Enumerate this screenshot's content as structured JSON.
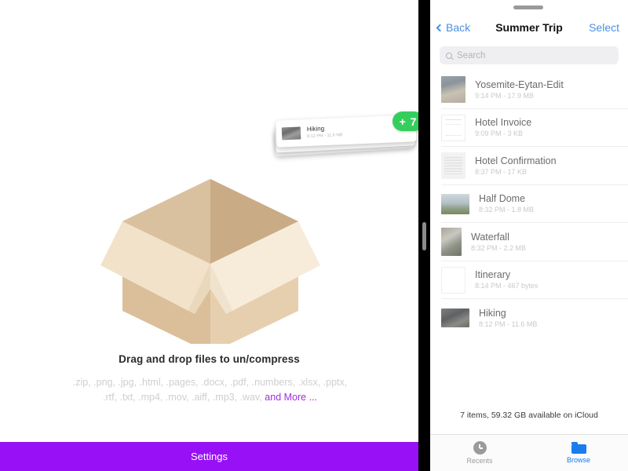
{
  "left_pane": {
    "illustration_icon": "open-cardboard-box-icon",
    "empty_title": "Drag and drop files to un/compress",
    "extensions_text": ".zip, .png, .jpg, .html, .pages, .docx, .pdf, .numbers, .xlsx, .pptx, .rtf, .txt, .mp4, .mov, .aiff, .mp3, .wav, ",
    "extensions_more_label": "and More ...",
    "accent_color": "#9810f5",
    "settings_label": "Settings",
    "drag_card": {
      "name": "Hiking",
      "meta": "8:12 PM - 11.6 MB",
      "badge_label": "+ 7",
      "badge_color": "#35ce5d"
    }
  },
  "divider": {
    "handle_icon": "drag-handle-icon"
  },
  "right_pane": {
    "grabber_icon": "sheet-grabber-icon",
    "nav": {
      "back_label": "Back",
      "back_icon": "chevron-left-icon",
      "title": "Summer Trip",
      "select_label": "Select",
      "tint_color": "#4a90e2"
    },
    "search": {
      "icon": "search-icon",
      "placeholder": "Search"
    },
    "files": [
      {
        "name": "Yosemite-Eytan-Edit",
        "meta": "9:14 PM - 17.9 MB",
        "thumb": "thumb-photo-yosemite"
      },
      {
        "name": "Hotel Invoice",
        "meta": "9:09 PM - 3 KB",
        "thumb": "thumb-doc-invoice"
      },
      {
        "name": "Hotel Confirmation",
        "meta": "8:37 PM - 17 KB",
        "thumb": "thumb-doc-text"
      },
      {
        "name": "Half Dome",
        "meta": "8:32 PM - 1.8 MB",
        "thumb": "thumb-photo-halfdome"
      },
      {
        "name": "Waterfall",
        "meta": "8:32 PM - 2.2 MB",
        "thumb": "thumb-photo-waterfall"
      },
      {
        "name": "Itinerary",
        "meta": "8:14 PM - 467 bytes",
        "thumb": "thumb-doc-blank"
      },
      {
        "name": "Hiking",
        "meta": "8:12 PM - 11.6 MB",
        "thumb": "thumb-photo-hiking"
      }
    ],
    "status_text": "7 items, 59.32 GB available on iCloud",
    "tabs": [
      {
        "label": "Recents",
        "icon": "clock-icon",
        "selected": false
      },
      {
        "label": "Browse",
        "icon": "folder-icon",
        "selected": true
      }
    ]
  }
}
